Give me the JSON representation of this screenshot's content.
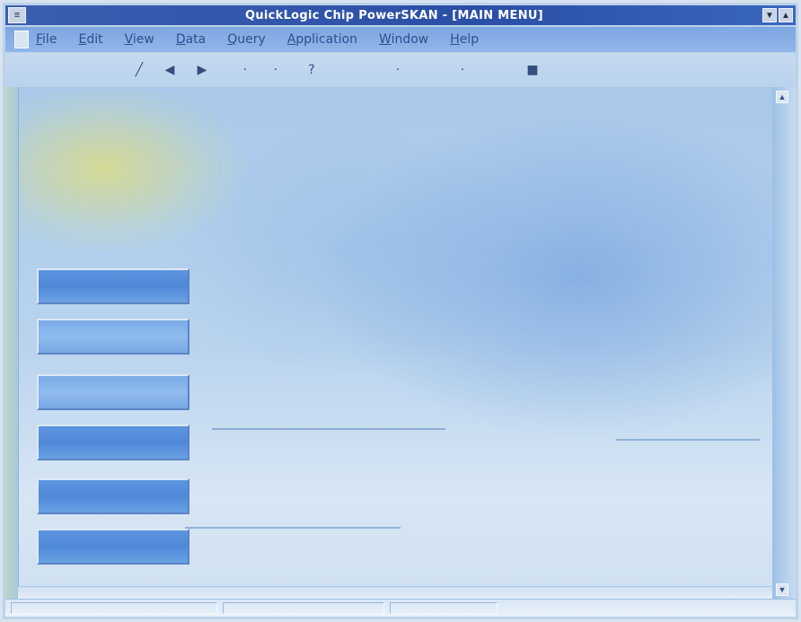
{
  "window": {
    "title": "QuickLogic Chip PowerSKAN - [MAIN MENU]",
    "sys_menu_glyph": "≡",
    "minimize_glyph": "▼",
    "maximize_glyph": "▲"
  },
  "menubar": {
    "items": [
      {
        "label": "File"
      },
      {
        "label": "Edit"
      },
      {
        "label": "View"
      },
      {
        "label": "Data"
      },
      {
        "label": "Query"
      },
      {
        "label": "Application"
      },
      {
        "label": "Window"
      },
      {
        "label": "Help"
      }
    ]
  },
  "toolbar": {
    "tools": [
      {
        "icon": "pointer-icon",
        "glyph": "╱"
      },
      {
        "icon": "triangle-left-icon",
        "glyph": "◀"
      },
      {
        "icon": "triangle-right-icon",
        "glyph": "▶"
      },
      {
        "icon": "dot-icon",
        "glyph": "·"
      },
      {
        "icon": "dot-icon",
        "glyph": "·"
      },
      {
        "icon": "help-icon",
        "glyph": "?"
      },
      {
        "icon": "dot-icon",
        "glyph": "·"
      },
      {
        "icon": "dot-icon",
        "glyph": "·"
      },
      {
        "icon": "save-icon",
        "glyph": "■"
      }
    ]
  },
  "side_buttons": [
    {
      "label": ""
    },
    {
      "label": ""
    },
    {
      "label": ""
    },
    {
      "label": ""
    },
    {
      "label": ""
    },
    {
      "label": ""
    }
  ],
  "colors": {
    "titlebar": "#2a4fa6",
    "menubar": "#86adE5",
    "workspace": "#b9d3ee",
    "button": "#4f88d8"
  }
}
